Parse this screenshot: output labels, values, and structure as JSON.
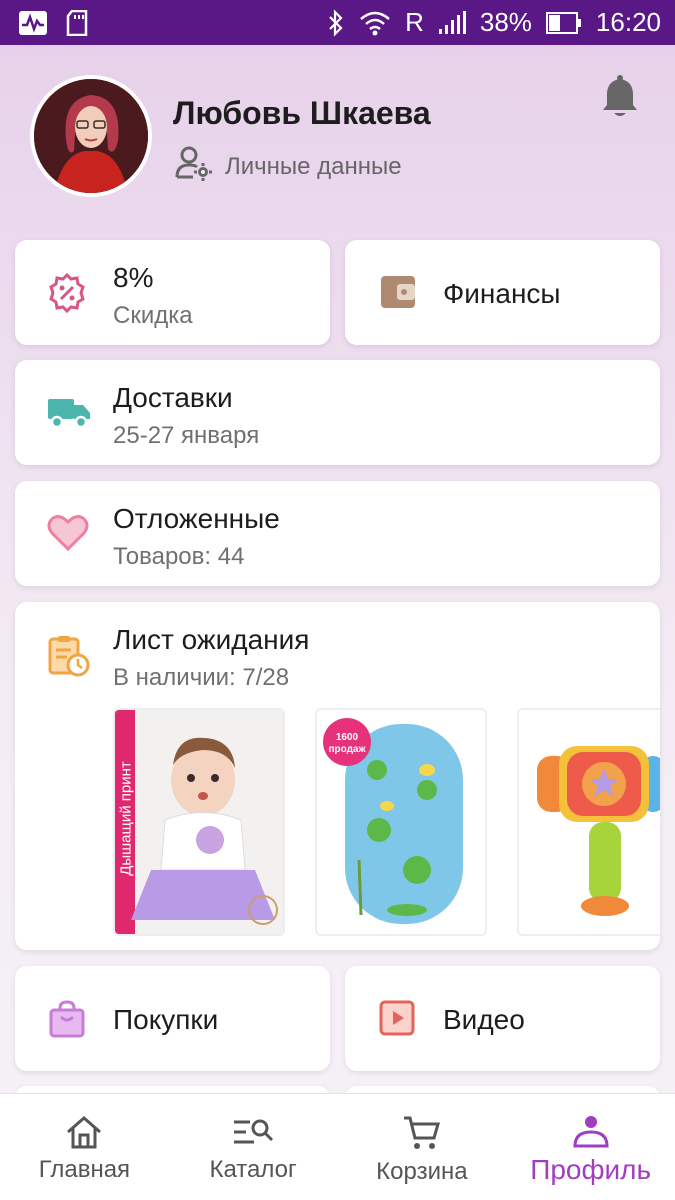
{
  "status_bar": {
    "carrier": "R",
    "battery": "38%",
    "time": "16:20"
  },
  "profile": {
    "name": "Любовь Шкаева",
    "personal_link": "Личные данные"
  },
  "cards": {
    "discount": {
      "value": "8%",
      "label": "Скидка"
    },
    "finance": {
      "label": "Финансы"
    },
    "deliveries": {
      "title": "Доставки",
      "subtitle": "25-27 января"
    },
    "saved": {
      "title": "Отложенные",
      "subtitle": "Товаров: 44"
    },
    "waitlist": {
      "title": "Лист ожидания",
      "subtitle": "В наличии: 7/28",
      "products": [
        {
          "name": "Дышащий принт",
          "badge": ""
        },
        {
          "name": "",
          "badge": "1600 продаж"
        },
        {
          "name": "",
          "badge": ""
        }
      ]
    },
    "purchases": {
      "label": "Покупки"
    },
    "video": {
      "label": "Видео"
    }
  },
  "bottom_nav": {
    "items": [
      {
        "label": "Главная",
        "icon": "home-icon"
      },
      {
        "label": "Каталог",
        "icon": "catalog-search-icon"
      },
      {
        "label": "Корзина",
        "icon": "cart-icon"
      },
      {
        "label": "Профиль",
        "icon": "profile-icon"
      }
    ],
    "active_color": "#a13ec0"
  },
  "colors": {
    "status_bar": "#5a1786",
    "discount_icon": "#d9577f",
    "finance_icon": "#b08a70",
    "delivery_icon": "#4bb6ad",
    "heart_icon": "#ef7f9e",
    "waitlist_icon": "#f0a540",
    "purchases_icon": "#c77dd8",
    "video_icon": "#e0655a"
  }
}
